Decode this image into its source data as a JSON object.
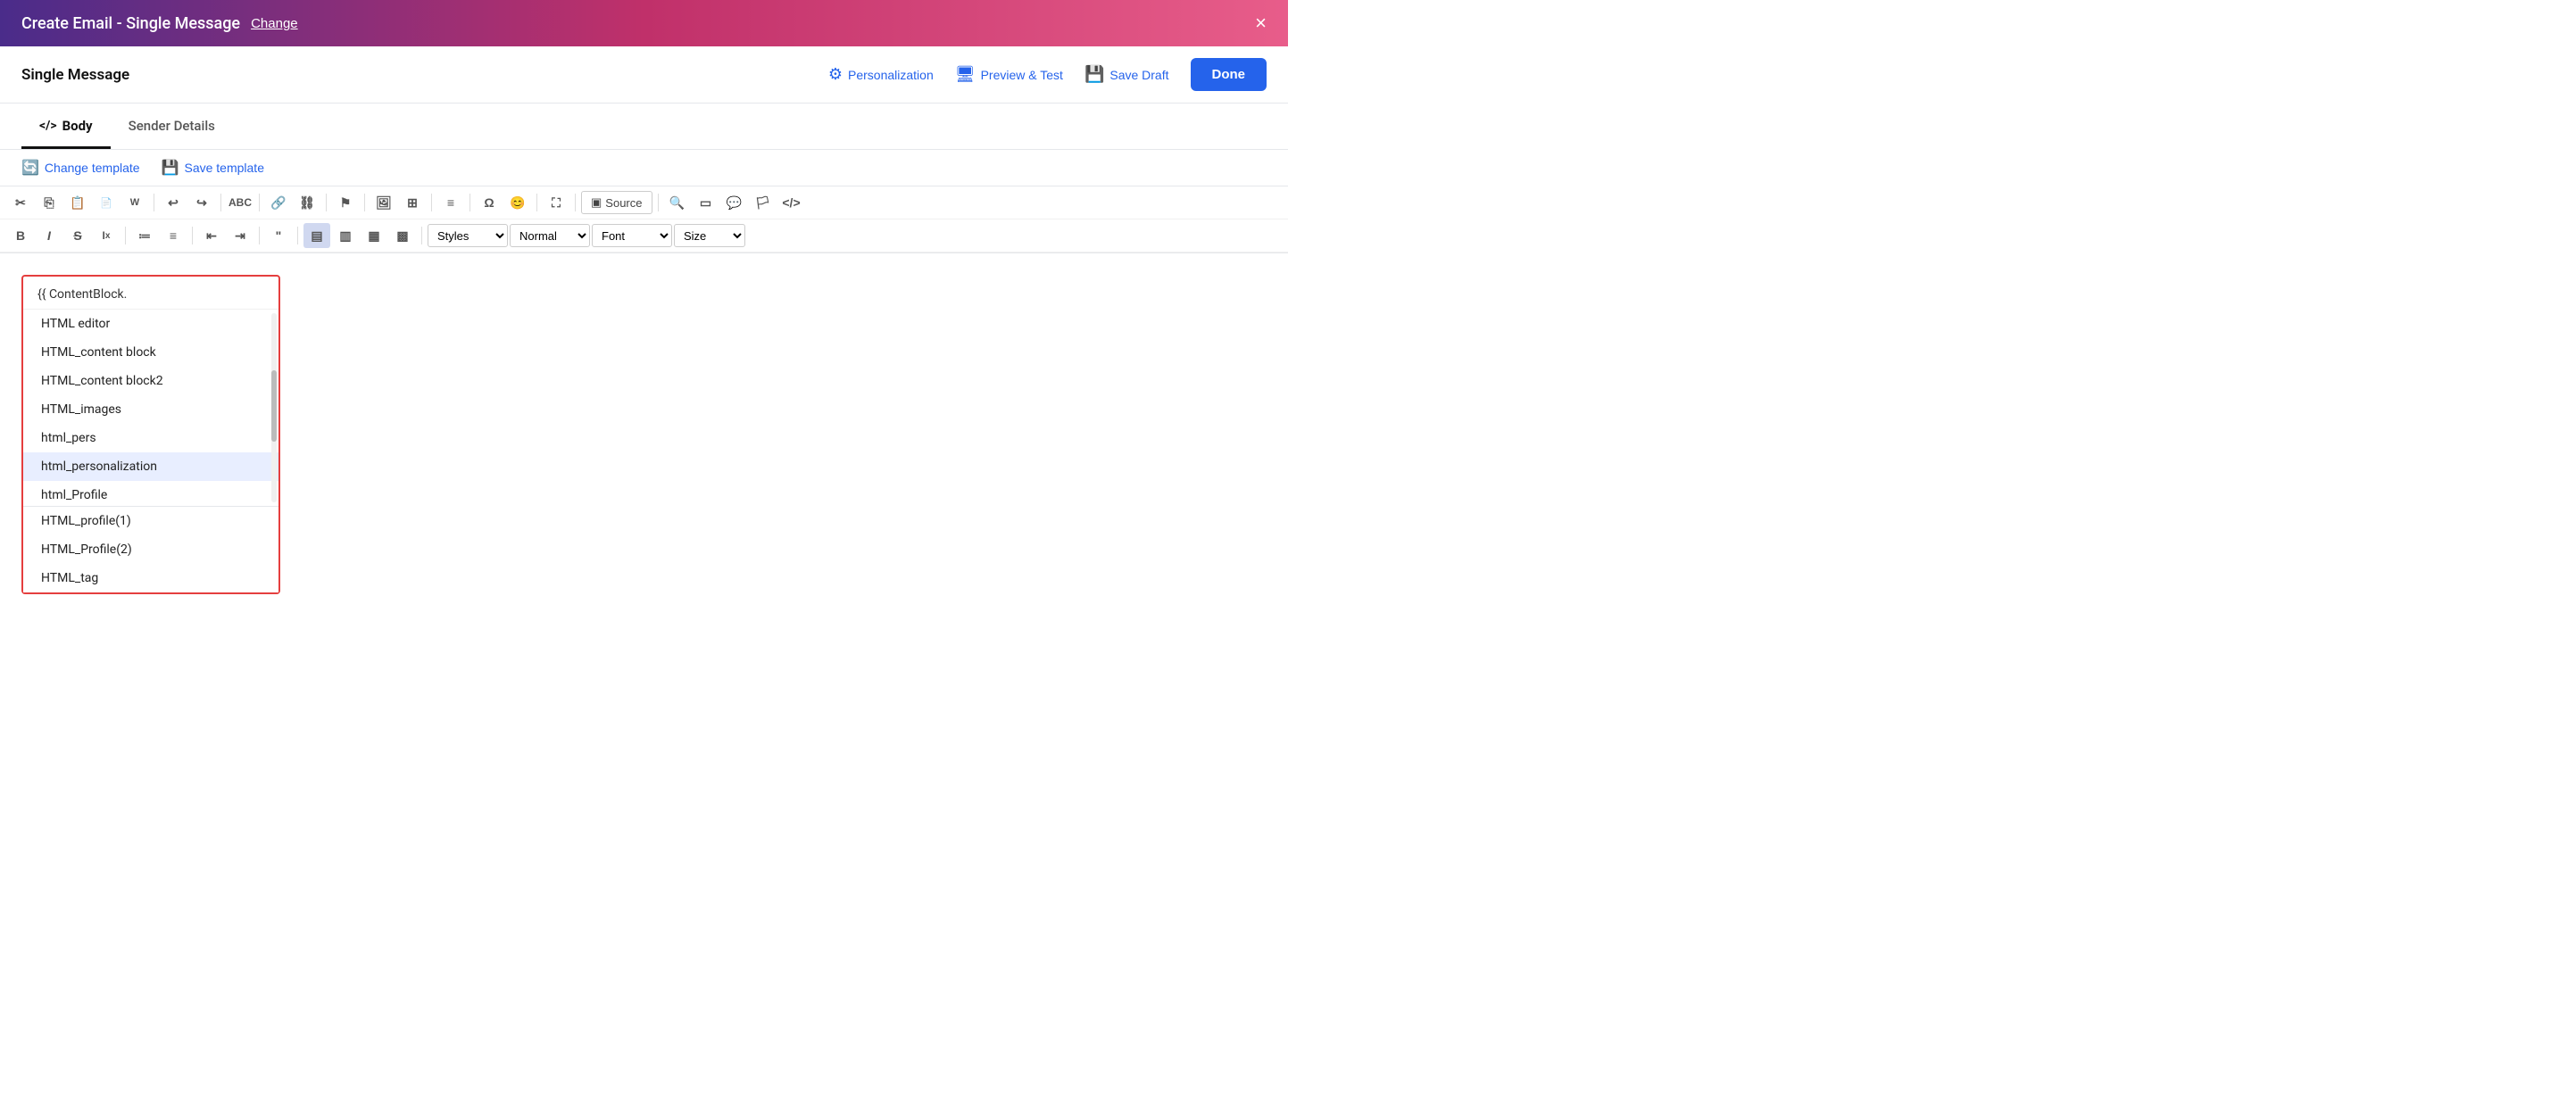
{
  "header": {
    "title": "Create Email - Single Message",
    "change_label": "Change",
    "close_label": "×"
  },
  "action_bar": {
    "title": "Single Message",
    "personalization_label": "Personalization",
    "preview_test_label": "Preview & Test",
    "save_draft_label": "Save Draft",
    "done_label": "Done"
  },
  "tabs": [
    {
      "id": "body",
      "label": "Body",
      "icon": "</>",
      "active": true
    },
    {
      "id": "sender_details",
      "label": "Sender Details",
      "active": false
    }
  ],
  "template_bar": {
    "change_template_label": "Change template",
    "save_template_label": "Save template"
  },
  "toolbar": {
    "source_label": "Source",
    "styles_label": "Styles",
    "normal_label": "Normal",
    "font_label": "Font",
    "size_label": "Size"
  },
  "editor": {
    "input_text": "{{ ContentBlock.",
    "dropdown_items": [
      "HTML editor",
      "HTML_content block",
      "HTML_content block2",
      "HTML_images",
      "html_pers",
      "html_personalization",
      "html_Profile",
      "HTML_profile(1)",
      "HTML_Profile(2)",
      "HTML_tag"
    ],
    "selected_item": "html_personalization"
  }
}
